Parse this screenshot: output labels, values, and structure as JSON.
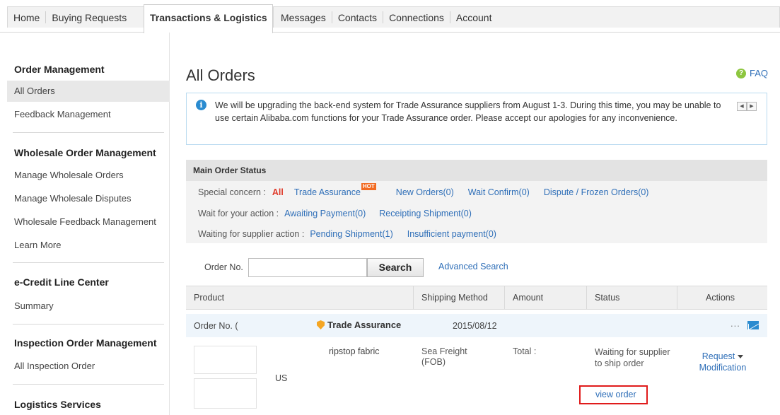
{
  "topnav": {
    "items": [
      "Home",
      "Buying Requests",
      "Transactions & Logistics",
      "Messages",
      "Contacts",
      "Connections",
      "Account"
    ],
    "active": "Transactions & Logistics"
  },
  "sidebar": {
    "sections": [
      {
        "title": "Order Management",
        "items": [
          "All Orders",
          "Feedback Management"
        ]
      },
      {
        "title": "Wholesale Order Management",
        "items": [
          "Manage Wholesale Orders",
          "Manage Wholesale Disputes",
          "Wholesale Feedback Management",
          "Learn More"
        ]
      },
      {
        "title": "e-Credit Line Center",
        "items": [
          "Summary"
        ]
      },
      {
        "title": "Inspection Order Management",
        "items": [
          "All Inspection Order"
        ]
      },
      {
        "title": "Logistics Services",
        "items": []
      }
    ],
    "active_item": "All Orders"
  },
  "main": {
    "title": "All Orders",
    "faq": "FAQ",
    "notice": "We will be upgrading the back-end system for Trade Assurance suppliers from August 1-3. During this time, you may be unable to use certain Alibaba.com functions for your Trade Assurance order. Please accept our apologies for any inconvenience.",
    "status_panel": {
      "heading": "Main Order Status",
      "special_label": "Special concern :",
      "special_all": "All",
      "trade_assurance": "Trade Assurance",
      "hot": "HOT",
      "new_orders": "New Orders(0)",
      "wait_confirm": "Wait Confirm(0)",
      "dispute": "Dispute / Frozen Orders(0)",
      "your_action_label": "Wait for your action :",
      "awaiting_payment": "Awaiting Payment(0)",
      "receipting": "Receipting Shipment(0)",
      "supplier_label": "Waiting for supplier action :",
      "pending_shipment": "Pending Shipment(1)",
      "insufficient": "Insufficient payment(0)"
    },
    "search": {
      "label": "Order No.",
      "value": "",
      "button": "Search",
      "advanced": "Advanced Search"
    },
    "table": {
      "headers": [
        "Product",
        "Shipping Method",
        "Amount",
        "Status",
        "Actions"
      ]
    },
    "order": {
      "order_no_label": "Order No. (",
      "trade_assurance": "Trade Assurance",
      "date": "2015/08/12",
      "more": "...",
      "product_name": "ripstop fabric",
      "country": "US",
      "shipping_line1": "Sea Freight",
      "shipping_line2": "(FOB)",
      "amount": "Total :",
      "status": "Waiting for supplier to ship order",
      "view_order": "view order",
      "action_line1": "Request",
      "action_line2": "Modification"
    }
  }
}
